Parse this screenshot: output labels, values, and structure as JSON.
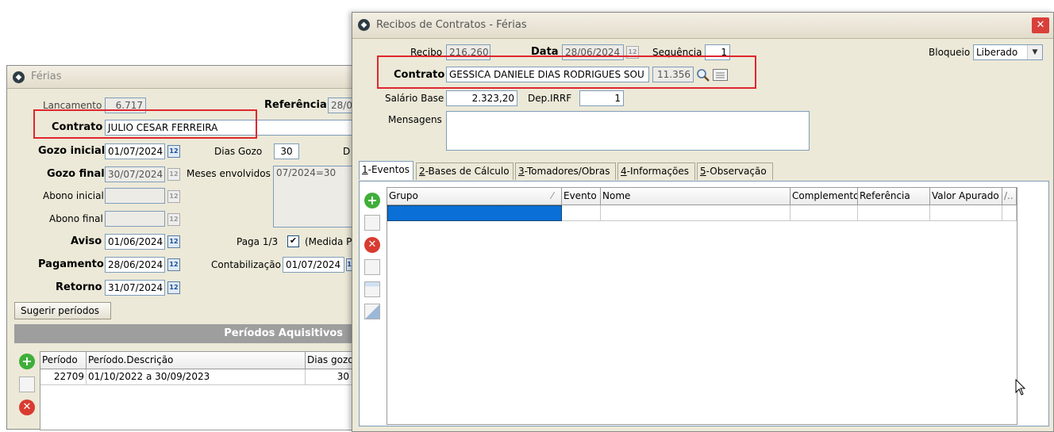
{
  "ferias": {
    "title": "Férias",
    "lancamento_label": "Lancamento",
    "lancamento_value": "6.717",
    "referencia_label": "Referência",
    "referencia_value": "28/0",
    "contrato_label": "Contrato",
    "contrato_value": "JULIO CESAR FERREIRA",
    "gozo_inicial_label": "Gozo inicial",
    "gozo_inicial_value": "01/07/2024",
    "dias_gozo_label": "Dias Gozo",
    "dias_gozo_value": "30",
    "d_label": "D",
    "gozo_final_label": "Gozo final",
    "gozo_final_value": "30/07/2024",
    "meses_label": "Meses envolvidos",
    "meses_value": "07/2024=30",
    "abono_inicial_label": "Abono inicial",
    "abono_final_label": "Abono final",
    "aviso_label": "Aviso",
    "aviso_value": "01/06/2024",
    "paga_label": "Paga 1/3",
    "paga_checked": "✔",
    "medida_label": "(Medida P",
    "pagamento_label": "Pagamento",
    "pagamento_value": "28/06/2024",
    "contabilizacao_label": "Contabilização",
    "contabilizacao_value": "01/07/2024",
    "retorno_label": "Retorno",
    "retorno_value": "31/07/2024",
    "sugerir_button": "Sugerir períodos",
    "periodos_header": "Períodos Aquisitivos",
    "periodos_columns": [
      "Período",
      "Período.Descrição",
      "Dias gozo"
    ],
    "periodos_rows": [
      {
        "periodo": "22709",
        "descricao": "01/10/2022 a 30/09/2023",
        "dias": "30"
      }
    ]
  },
  "recibos": {
    "title": "Recibos de Contratos - Férias",
    "close_icon": "✕",
    "recibo_label": "Recibo",
    "recibo_value": "216.260",
    "data_label": "Data",
    "data_value": "28/06/2024",
    "sequencia_label": "Sequência",
    "sequencia_value": "1",
    "bloqueio_label": "Bloqueio",
    "bloqueio_value": "Liberado",
    "contrato_label": "Contrato",
    "contrato_value": "GESSICA DANIELE DIAS RODRIGUES SOU",
    "contrato_code": "11.356",
    "salario_label": "Salário Base",
    "salario_value": "2.323,20",
    "depirrf_label": "Dep.IRRF",
    "depirrf_value": "1",
    "mensagens_label": "Mensagens",
    "mensagens_value": "",
    "tabs": [
      {
        "key": "1",
        "rest": "-Eventos"
      },
      {
        "key": "2",
        "rest": "-Bases de Cálculo"
      },
      {
        "key": "3",
        "rest": "-Tomadores/Obras"
      },
      {
        "key": "4",
        "rest": "-Informações"
      },
      {
        "key": "5",
        "rest": "-Observação"
      }
    ],
    "grid_columns": [
      "Grupo",
      "Evento",
      "Nome",
      "Complemento",
      "Referência",
      "Valor Apurado",
      "/.."
    ]
  },
  "colors": {
    "highlight": "#e0262d",
    "selection": "#0a6fd6",
    "section_header": "#9e9e9e"
  }
}
